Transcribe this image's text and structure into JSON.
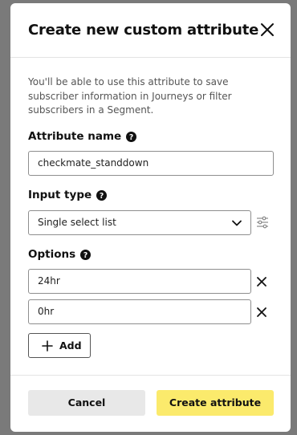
{
  "modal": {
    "title": "Create new custom attribute",
    "description": "You'll be able to use this attribute to save subscriber information in Journeys or filter subscribers in a Segment."
  },
  "attribute_name": {
    "label": "Attribute name",
    "value": "checkmate_standdown"
  },
  "input_type": {
    "label": "Input type",
    "selected": "Single select list"
  },
  "options": {
    "label": "Options",
    "items": [
      "24hr",
      "0hr"
    ],
    "add_label": "Add"
  },
  "footer": {
    "cancel_label": "Cancel",
    "create_label": "Create attribute"
  },
  "colors": {
    "primary_button": "#fbea6c",
    "secondary_button": "#e8e8e8",
    "overlay": "#7a7a7a"
  },
  "icons": [
    "close-icon",
    "help-icon",
    "chevron-down-icon",
    "settings-sliders-icon",
    "remove-icon",
    "plus-icon"
  ]
}
